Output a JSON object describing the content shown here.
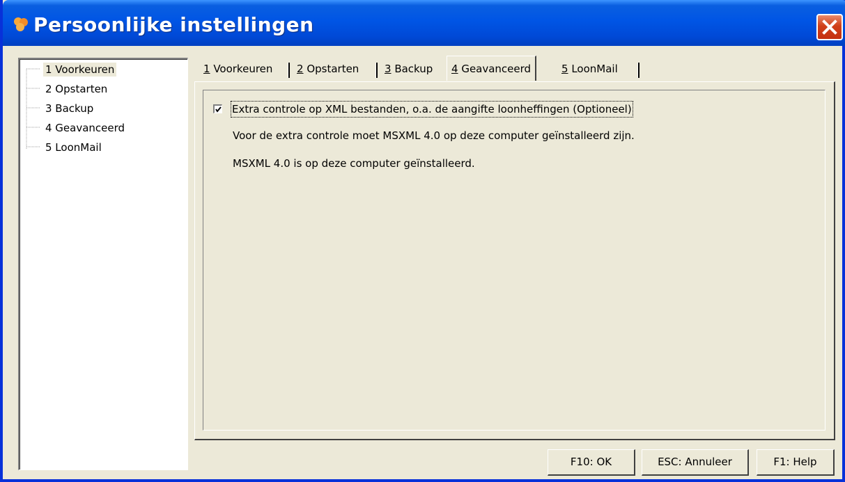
{
  "window": {
    "title": "Persoonlijke instellingen",
    "close_label": "×"
  },
  "colors": {
    "titlebar": "#0055e5",
    "face": "#ece9d8",
    "close": "#d0401a"
  },
  "tree": {
    "items": [
      {
        "label": "1 Voorkeuren",
        "selected": true
      },
      {
        "label": "2 Opstarten"
      },
      {
        "label": "3 Backup"
      },
      {
        "label": "4 Geavanceerd"
      },
      {
        "label": "5 LoonMail"
      }
    ]
  },
  "tabs": [
    {
      "key": "1",
      "label": " Voorkeuren"
    },
    {
      "key": "2",
      "label": " Opstarten"
    },
    {
      "key": "3",
      "label": " Backup"
    },
    {
      "key": "4",
      "label": " Geavanceerd",
      "active": true
    },
    {
      "key": "5",
      "label": " LoonMail"
    }
  ],
  "advanced": {
    "xml_check_label": "Extra controle op XML bestanden, o.a. de aangifte loonheffingen (Optioneel)",
    "xml_check_checked": true,
    "info_line1": "Voor de extra controle moet MSXML 4.0 op deze computer geïnstalleerd zijn.",
    "info_line2": "MSXML 4.0 is op deze computer geïnstalleerd."
  },
  "buttons": {
    "ok": "F10: OK",
    "cancel": "ESC: Annuleer",
    "help": "F1: Help"
  }
}
